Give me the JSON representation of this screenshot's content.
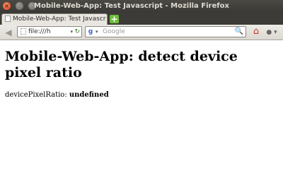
{
  "window": {
    "title": "Mobile-Web-App: Test Javascript - Mozilla Firefox",
    "close_glyph": "×"
  },
  "tabs": [
    {
      "label": "Mobile-Web-App: Test Javascr",
      "active": true
    }
  ],
  "new_tab_glyph": "+",
  "navbar": {
    "back_glyph": "◀",
    "url": "file:///h",
    "url_dropdown_glyph": "▾",
    "reload_glyph": "↻",
    "search_placeholder": "Google",
    "search_engine_glyph": "g",
    "search_dropdown_glyph": "▾",
    "search_go_glyph": "🔍",
    "home_glyph": "⌂",
    "extra_glyph": "● ▾"
  },
  "page": {
    "heading": "Mobile-Web-App: detect device pixel ratio",
    "result_label": "devicePixelRatio:",
    "result_value": "undefined"
  },
  "colors": {
    "titlebar": "#3c3b37",
    "close_button": "#d9461b",
    "new_tab_button": "#6fbf3a"
  }
}
